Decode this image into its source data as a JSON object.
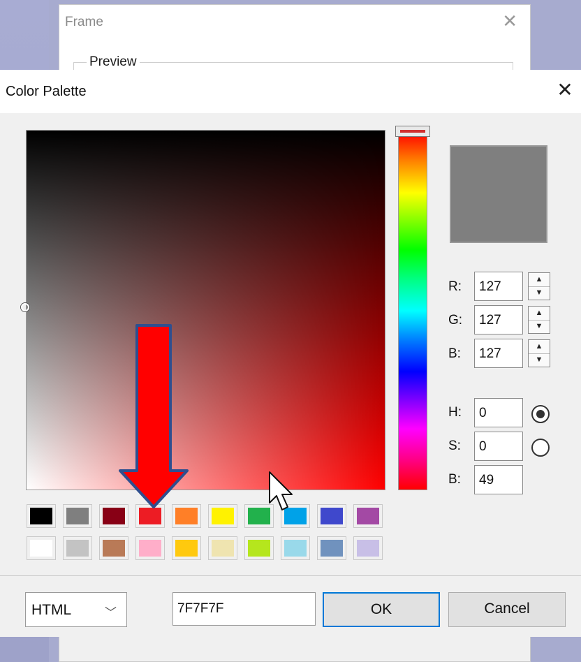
{
  "background_window": {
    "title": "Frame",
    "group_label": "Preview"
  },
  "dialog": {
    "title": "Color Palette",
    "close_icon": "close-icon"
  },
  "current_color": {
    "hex": "7F7F7F",
    "preview": "#7F7F7F",
    "r": "127",
    "g": "127",
    "b": "127",
    "h": "0",
    "s": "0",
    "br": "49",
    "selected_mode": "H"
  },
  "labels": {
    "r": "R:",
    "g": "G:",
    "b": "B:",
    "h": "H:",
    "s": "S:",
    "br": "B:"
  },
  "swatches": {
    "row1": [
      "#000000",
      "#7f7f7f",
      "#880015",
      "#ed1c24",
      "#ff7f27",
      "#fff200",
      "#22b14c",
      "#00a2e8",
      "#3f48cc",
      "#a349a4"
    ],
    "row2": [
      "#ffffff",
      "#c3c3c3",
      "#b97a57",
      "#ffaec9",
      "#ffc90e",
      "#efe4b0",
      "#b5e61d",
      "#99d9ea",
      "#7092be",
      "#c8bfe7"
    ]
  },
  "footer": {
    "format": "HTML",
    "format_icon": "chevron-down-icon",
    "ok": "OK",
    "cancel": "Cancel"
  },
  "annotation": {
    "arrow_color": "#ff0000",
    "arrow_outline": "#2f4f8f"
  }
}
